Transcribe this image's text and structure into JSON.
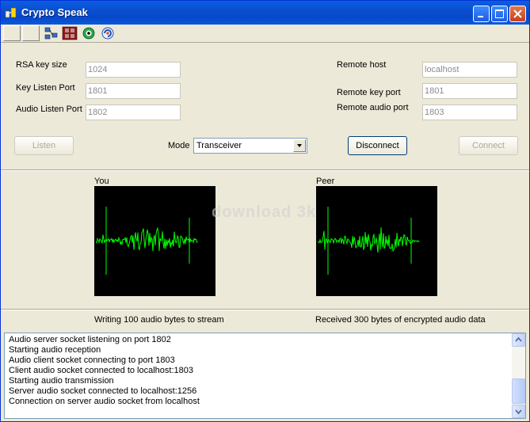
{
  "window": {
    "title": "Crypto Speak"
  },
  "toolbar": {
    "icons": [
      "blank-tool",
      "blank-tool",
      "network-icon",
      "film-icon",
      "eye-icon",
      "refresh-icon"
    ]
  },
  "local": {
    "rsa_label": "RSA key size",
    "rsa_value": "1024",
    "key_port_label": "Key Listen Port",
    "key_port_value": "1801",
    "audio_port_label": "Audio Listen Port",
    "audio_port_value": "1802"
  },
  "remote": {
    "host_label": "Remote host",
    "host_value": "localhost",
    "key_port_label": "Remote key port",
    "key_port_value": "1801",
    "audio_port_label": "Remote audio port",
    "audio_port_value": "1803"
  },
  "controls": {
    "listen_label": "Listen",
    "mode_label": "Mode",
    "mode_value": "Transceiver",
    "disconnect_label": "Disconnect",
    "connect_label": "Connect"
  },
  "scopes": {
    "you_label": "You",
    "peer_label": "Peer",
    "trace_color": "#00ff00"
  },
  "status": {
    "you": "Writing 100 audio bytes to stream",
    "peer": "Received 300 bytes of encrypted audio data"
  },
  "watermark": "download 3k",
  "log": [
    "Audio server socket listening on port 1802",
    "Starting audio reception",
    "Audio client socket connecting to port 1803",
    "Client audio socket connected to localhost:1803",
    "Starting audio transmission",
    "Server audio socket connected to localhost:1256",
    "Connection on server audio socket from localhost"
  ]
}
